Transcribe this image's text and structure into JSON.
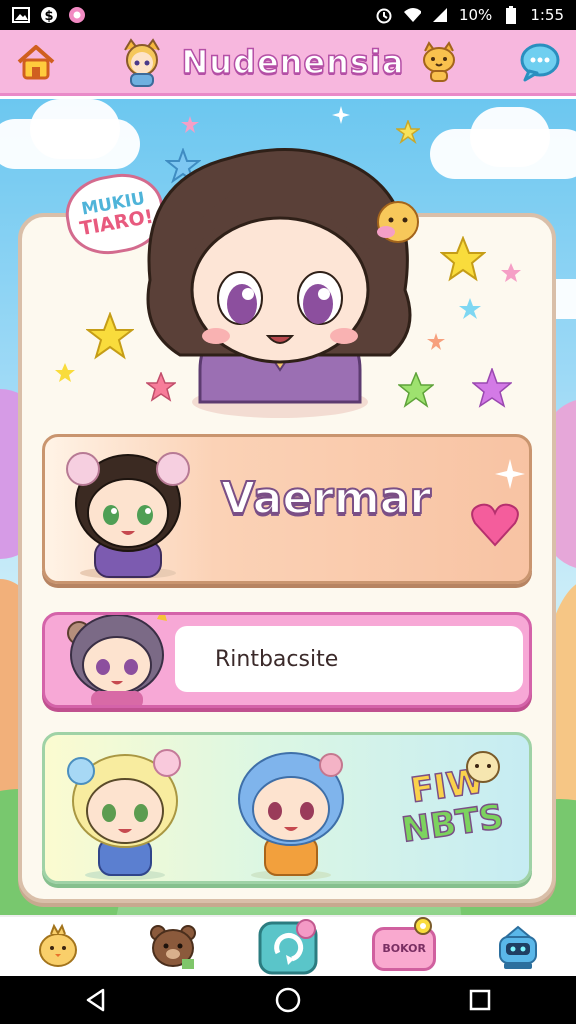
{
  "status_bar": {
    "icons_left": [
      "photo-icon",
      "dollar-icon",
      "candy-icon"
    ],
    "icons_right": [
      "alarm-icon",
      "wifi-icon",
      "signal-icon"
    ],
    "battery_percent": "10%",
    "time": "1:55"
  },
  "header": {
    "title": "Nudenensia",
    "icons": [
      "home-icon",
      "chibi-mascot-icon",
      "cat-mascot-icon",
      "chat-bubble-icon"
    ]
  },
  "hero": {
    "speech_line1": "MUKIU",
    "speech_line2": "TIARO!"
  },
  "menu": {
    "item1_label": "Vaermar",
    "item2_label": "Rintbacsite",
    "item3_line1": "FIW",
    "item3_line2": "NBTS"
  },
  "bottom_nav": {
    "items": [
      "chick-icon",
      "bear-icon",
      "refresh-icon",
      "badge",
      "robot-icon"
    ],
    "badge_label": "BOKOR"
  },
  "system_nav": [
    "back-icon",
    "home-circle-icon",
    "recents-icon"
  ],
  "colors": {
    "header_bg": "#f7b7de",
    "accent_pink": "#e98ac8",
    "title_stroke": "#b44fa6",
    "card_bg": "#fdf9ef"
  }
}
